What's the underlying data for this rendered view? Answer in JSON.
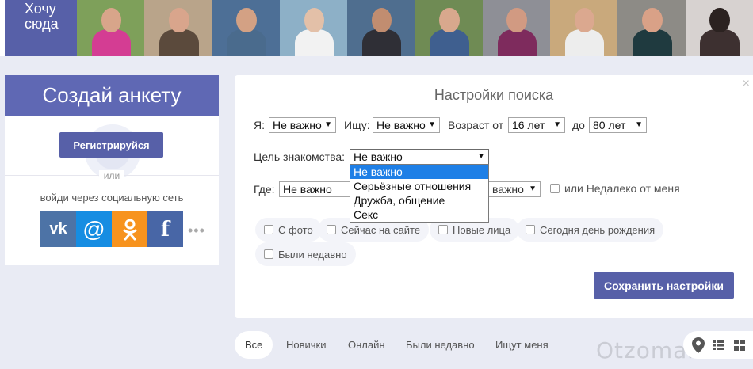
{
  "top_strip": {
    "want_here": "Хочу сюда",
    "photos": [
      {
        "bg": "#7ea05a",
        "skin": "#d8a58a",
        "cloth": "#d43d93"
      },
      {
        "bg": "#b9a48a",
        "skin": "#d9a58c",
        "cloth": "#5b4a3c"
      },
      {
        "bg": "#4d6f96",
        "skin": "#d3a184",
        "cloth": "#4a6b8d"
      },
      {
        "bg": "#8db0c7",
        "skin": "#e3c0a8",
        "cloth": "#f2f2f2"
      },
      {
        "bg": "#4f6e8f",
        "skin": "#c18d70",
        "cloth": "#2f2f36"
      },
      {
        "bg": "#6f8b54",
        "skin": "#d8a88d",
        "cloth": "#3f5f8f"
      },
      {
        "bg": "#8e8f96",
        "skin": "#d19a82",
        "cloth": "#7e2b5d"
      },
      {
        "bg": "#c9a97c",
        "skin": "#dba88f",
        "cloth": "#ededed"
      },
      {
        "bg": "#8d8b86",
        "skin": "#d9a187",
        "cloth": "#1f3a3f"
      },
      {
        "bg": "#d7d2d0",
        "skin": "#2b2220",
        "cloth": "#3d3030"
      }
    ]
  },
  "register": {
    "title": "Создай анкету",
    "button": "Регистрируйся",
    "or": "или",
    "social_text": "войди через социальную сеть",
    "social": [
      {
        "name": "vk",
        "glyph": "vk"
      },
      {
        "name": "mail",
        "glyph": "@"
      },
      {
        "name": "ok",
        "glyph": "ok"
      },
      {
        "name": "facebook",
        "glyph": "f"
      }
    ],
    "more": "•••"
  },
  "settings": {
    "title": "Настройки поиска",
    "close": "×",
    "i_label": "Я:",
    "i_value": "Не важно",
    "seek_label": "Ищу:",
    "seek_value": "Не важно",
    "age_label": "Возраст от",
    "age_from": "16 лет",
    "age_to_label": "до",
    "age_to": "80 лет",
    "goal_label": "Цель знакомства:",
    "goal_value": "Не важно",
    "goal_options": [
      "Не важно",
      "Серьёзные отношения",
      "Дружба, общение",
      "Секс"
    ],
    "where_label": "Где:",
    "where_value": "Не важно",
    "where_value2": "важно",
    "nearby": "или Недалеко от меня",
    "filters": [
      "С фото",
      "Сейчас на сайте",
      "Новые лица",
      "Сегодня день рождения",
      "Были недавно"
    ],
    "save": "Сохранить настройки"
  },
  "tabs": [
    "Все",
    "Новички",
    "Онлайн",
    "Были недавно",
    "Ищут меня"
  ],
  "watermark": "Otzoman.com",
  "colors": {
    "accent": "#5760a8",
    "page_bg": "#e9ebf4",
    "dropdown_highlight": "#1e7fe6"
  }
}
